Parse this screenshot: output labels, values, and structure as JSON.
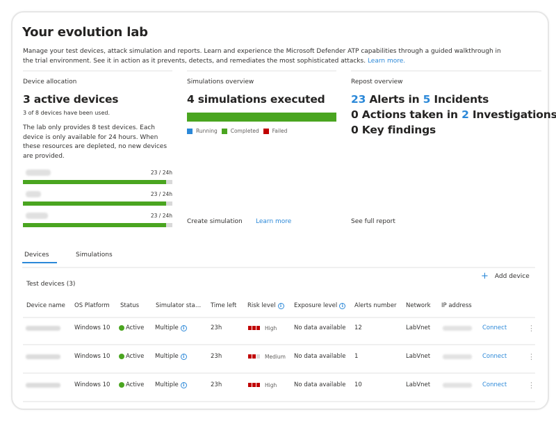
{
  "header": {
    "title": "Your evolution lab",
    "description": "Manage your test devices, attack simulation and reports. Learn and experience the Microsoft Defender ATP capabilities through a guided walkthrough in the trial environment. See it in action as it prevents, detects, and remediates the most sophisticated attacks.",
    "learn_more": "Learn more."
  },
  "device_allocation": {
    "label": "Device allocation",
    "headline": "3 active devices",
    "used": "3 of 8 devices have been used.",
    "note": "The lab only provides 8 test devices. Each device is only available for 24 hours. When these resources are depleted, no new devices are provided.",
    "devices": [
      {
        "name": "[blurred]",
        "usage": "23 / 24h",
        "fraction": 0.958
      },
      {
        "name": "[blurred]",
        "usage": "23 / 24h",
        "fraction": 0.958
      },
      {
        "name": "[blurred]",
        "usage": "23 / 24h",
        "fraction": 0.958
      }
    ]
  },
  "simulations": {
    "label": "Simulations overview",
    "headline": "4 simulations executed",
    "breakdown": {
      "running": 0,
      "completed": 4,
      "failed": 0
    },
    "legend": [
      {
        "label": "Running",
        "color": "#2b88d8"
      },
      {
        "label": "Completed",
        "color": "#4aa520"
      },
      {
        "label": "Failed",
        "color": "#c00000"
      }
    ],
    "create_label": "Create simulation",
    "learn_more": "Learn more"
  },
  "report": {
    "label": "Repost overview",
    "line1": {
      "alerts": "23",
      "alerts_text": " Alerts in ",
      "incidents": "5",
      "incidents_text": " Incidents"
    },
    "line2": {
      "actions": "0",
      "actions_text": " Actions taken in ",
      "investigations": "2",
      "investigations_text": " Investigations"
    },
    "line3": "0 Key findings",
    "see_full": "See full report"
  },
  "tabs": [
    {
      "label": "Devices",
      "active": true
    },
    {
      "label": "Simulations",
      "active": false
    }
  ],
  "table": {
    "title": "Test devices (3)",
    "add_device": "Add device",
    "columns": [
      "Device name",
      "OS Platform",
      "Status",
      "Simulator sta…",
      "Time left",
      "Risk level",
      "Exposure level",
      "Alerts number",
      "Network",
      "IP address"
    ],
    "rows": [
      {
        "device": "[blurred]",
        "os": "Windows 10",
        "status": "Active",
        "simulator": "Multiple",
        "time_left": "23h",
        "risk": "High",
        "risk_bars": 3,
        "exposure": "No data available",
        "alerts": "12",
        "network": "LabVnet",
        "ip": "[blurred]",
        "action": "Connect"
      },
      {
        "device": "[blurred]",
        "os": "Windows 10",
        "status": "Active",
        "simulator": "Multiple",
        "time_left": "23h",
        "risk": "Medium",
        "risk_bars": 2,
        "exposure": "No data available",
        "alerts": "1",
        "network": "LabVnet",
        "ip": "[blurred]",
        "action": "Connect"
      },
      {
        "device": "[blurred]",
        "os": "Windows 10",
        "status": "Active",
        "simulator": "Multiple",
        "time_left": "23h",
        "risk": "High",
        "risk_bars": 3,
        "exposure": "No data available",
        "alerts": "10",
        "network": "LabVnet",
        "ip": "[blurred]",
        "action": "Connect"
      }
    ]
  },
  "colors": {
    "accent": "#2b88d8",
    "success": "#4aa520",
    "danger": "#c00000"
  }
}
